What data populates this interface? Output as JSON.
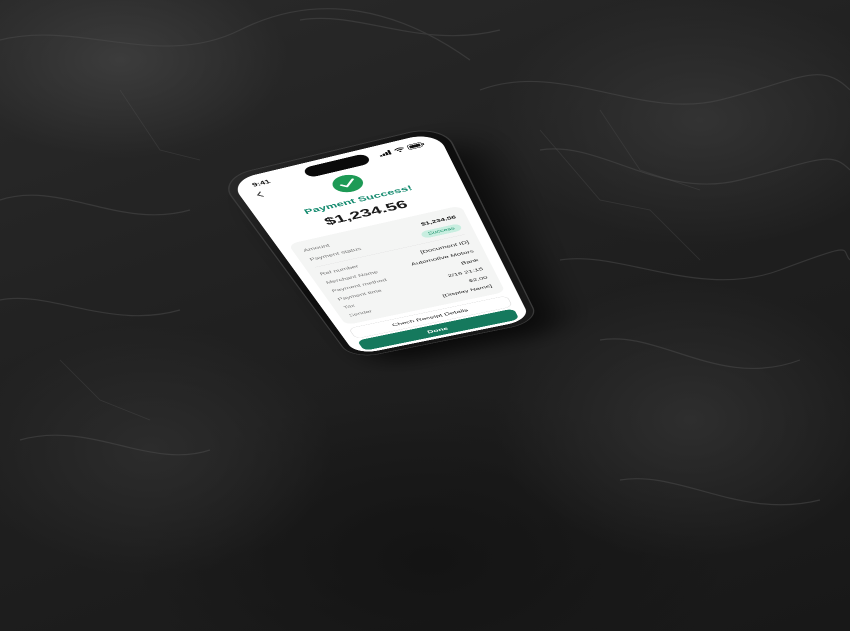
{
  "status_bar": {
    "time": "9:41"
  },
  "header": {
    "back_icon": "chevron-left-icon",
    "success_icon": "check-circle-icon"
  },
  "title": "Payment Success!",
  "amount": "$1,234.56",
  "details": {
    "rows": [
      {
        "label": "Amount",
        "value": "$1,234.56"
      },
      {
        "label": "Payment status",
        "value": "Success"
      },
      {
        "label": "Ref number",
        "value": "[Document ID]"
      },
      {
        "label": "Merchant Name",
        "value": "Automotive Motors"
      },
      {
        "label": "Payment method",
        "value": "Bank"
      },
      {
        "label": "Payment time",
        "value": "2/16 21:15"
      },
      {
        "label": "Tax",
        "value": "$2.00"
      },
      {
        "label": "Sender",
        "value": "[Display Name]"
      }
    ]
  },
  "buttons": {
    "receipt": "Chech Receipt Details",
    "done": "Done"
  },
  "colors": {
    "accent": "#15795d",
    "success": "#1d9a55",
    "badge_bg": "#c8eee0",
    "background": "#1c1c1c"
  }
}
